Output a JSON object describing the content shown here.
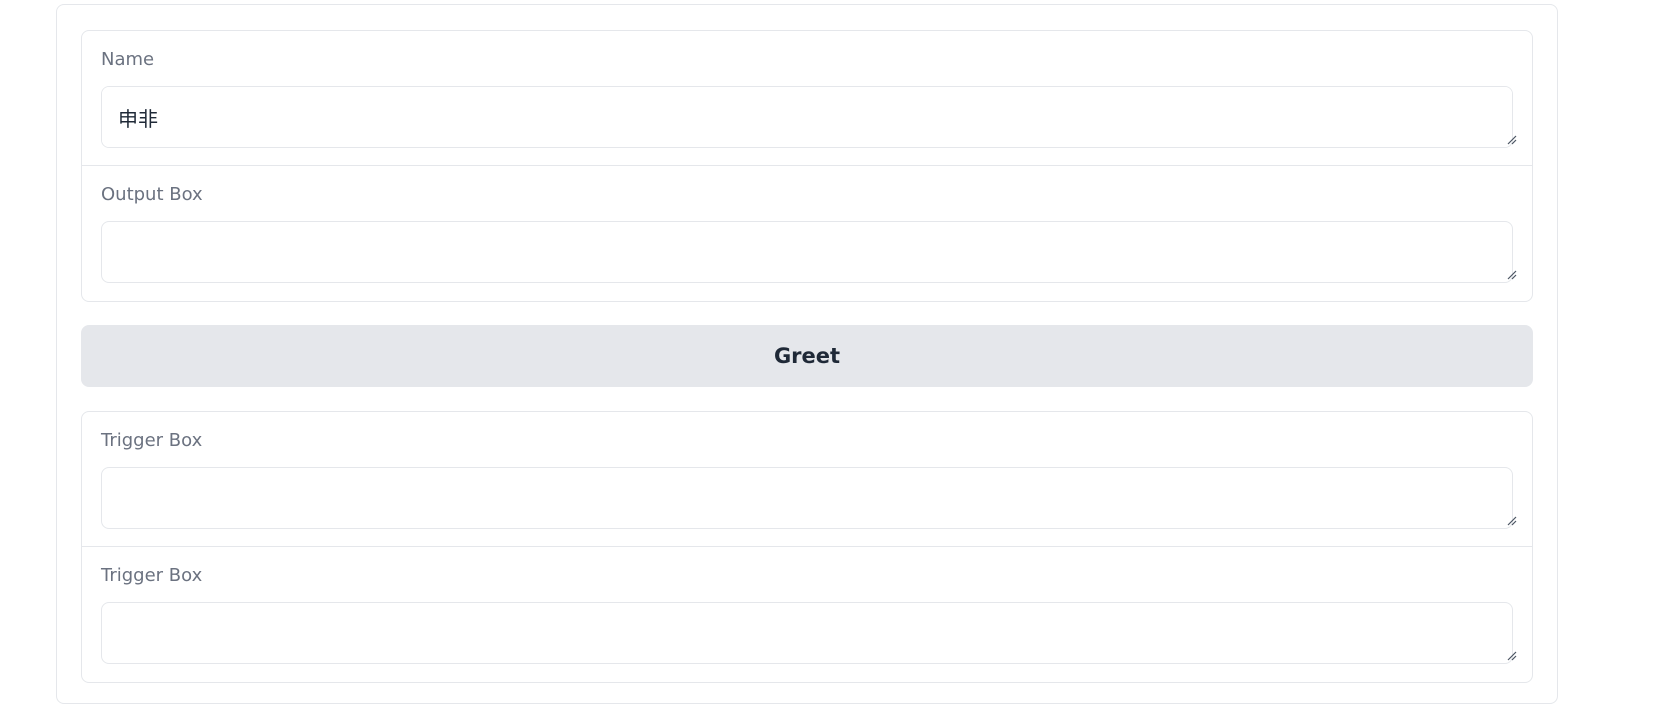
{
  "fields": {
    "name": {
      "label": "Name",
      "value": "申非"
    },
    "output": {
      "label": "Output Box",
      "value": ""
    },
    "trigger1": {
      "label": "Trigger Box",
      "value": ""
    },
    "trigger2": {
      "label": "Trigger Box",
      "value": ""
    }
  },
  "greet_button": {
    "label": "Greet"
  },
  "icons": {
    "resize": "resize-handle-icon"
  },
  "colors": {
    "border": "#e5e7eb",
    "button_bg": "#e5e7eb",
    "label_text": "#6b7280",
    "body_text": "#1f2937"
  }
}
